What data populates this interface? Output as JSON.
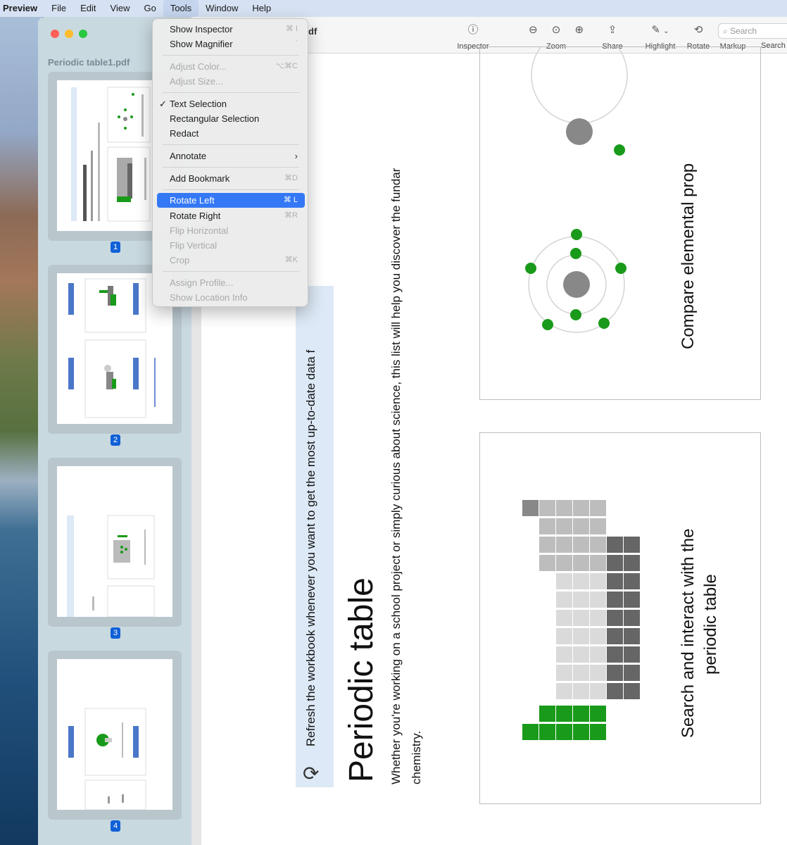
{
  "menubar": {
    "app": "Preview",
    "items": [
      "File",
      "Edit",
      "View",
      "Go",
      "Tools",
      "Window",
      "Help"
    ],
    "active": "Tools"
  },
  "sidebar": {
    "document_name": "Periodic table1.pdf",
    "pages": [
      "1",
      "2",
      "3",
      "4"
    ]
  },
  "toolbar": {
    "title_fragment": "df",
    "inspector": "Inspector",
    "zoom": "Zoom",
    "share": "Share",
    "highlight": "Highlight",
    "rotate": "Rotate",
    "markup": "Markup",
    "search_placeholder": "Search",
    "search_label": "Search"
  },
  "tools_menu": {
    "show_inspector": "Show Inspector",
    "show_inspector_sc": "⌘ I",
    "show_magnifier": "Show Magnifier",
    "show_magnifier_sc": "`",
    "adjust_color": "Adjust Color...",
    "adjust_color_sc": "⌥⌘C",
    "adjust_size": "Adjust Size...",
    "text_selection": "Text Selection",
    "text_selection_check": "✓",
    "rectangular_selection": "Rectangular Selection",
    "redact": "Redact",
    "annotate": "Annotate",
    "annotate_arrow": "›",
    "add_bookmark": "Add Bookmark",
    "add_bookmark_sc": "⌘D",
    "rotate_left": "Rotate Left",
    "rotate_left_sc": "⌘ L",
    "rotate_right": "Rotate Right",
    "rotate_right_sc": "⌘R",
    "flip_horizontal": "Flip Horizontal",
    "flip_vertical": "Flip Vertical",
    "crop": "Crop",
    "crop_sc": "⌘K",
    "assign_profile": "Assign Profile...",
    "show_location_info": "Show Location Info"
  },
  "document": {
    "refresh_text": "Refresh the workbook whenever you want to get the most up-to-date data f",
    "title": "Periodic table",
    "body_line1": "Whether you're working on a school project or simply curious about science, this list will help you discover the fundar",
    "body_line2": "chemistry.",
    "compare_card": "Compare elemental prop",
    "search_card_line1": "Search and interact with the",
    "search_card_line2": "periodic table"
  },
  "colors": {
    "accent_blue": "#3478f6",
    "element_green": "#1a9a1a",
    "band_blue": "#dde9f6"
  }
}
